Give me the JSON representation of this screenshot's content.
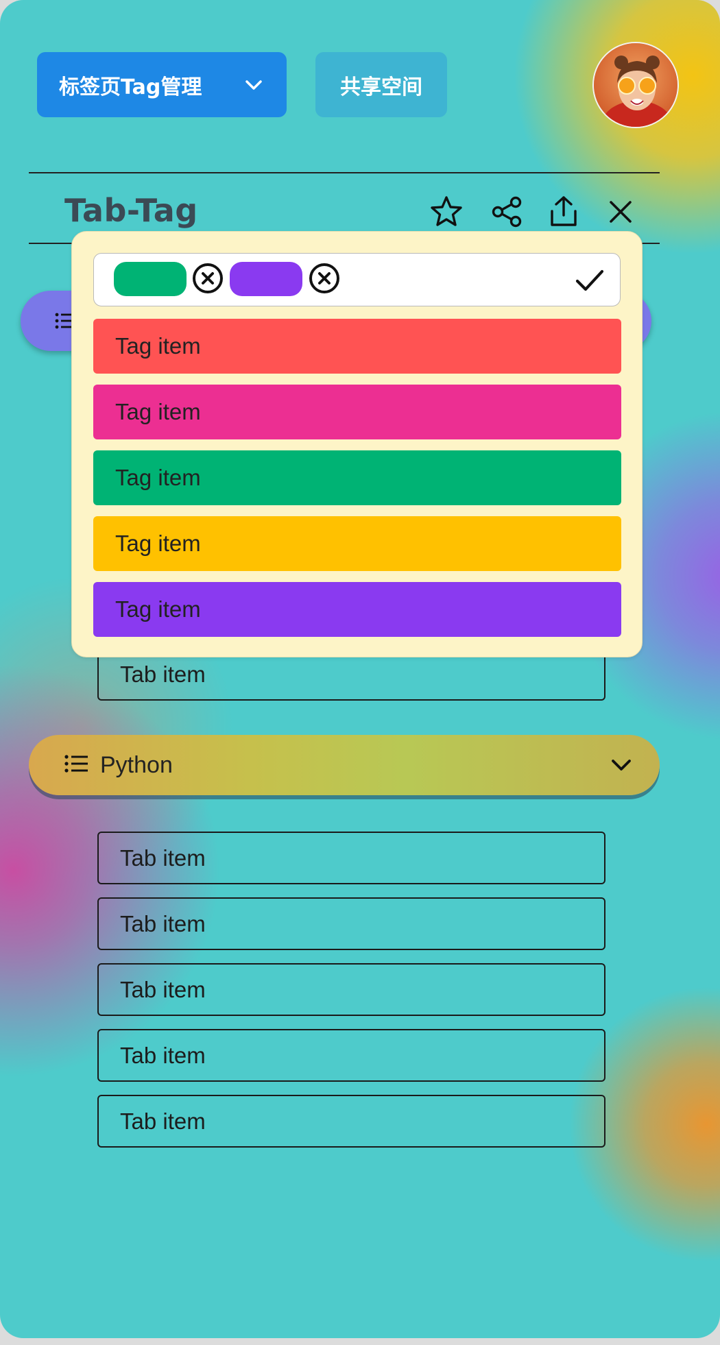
{
  "header": {
    "tag_manager_label": "标签页Tag管理",
    "shared_space_label": "共享空间"
  },
  "toolbar": {
    "title": "Tab-Tag",
    "icons": [
      "star-icon",
      "share-icon",
      "upload-icon",
      "close-icon"
    ]
  },
  "tag_picker": {
    "selected_chips": [
      {
        "color": "#00b374"
      },
      {
        "color": "#8a3af0"
      }
    ],
    "tags": [
      {
        "label": "Tag item",
        "color": "#ff5353"
      },
      {
        "label": "Tag item",
        "color": "#ec2f92"
      },
      {
        "label": "Tag item",
        "color": "#00b374"
      },
      {
        "label": "Tag item",
        "color": "#ffc100"
      },
      {
        "label": "Tag item",
        "color": "#8a3af0"
      }
    ]
  },
  "groups": [
    {
      "label": "",
      "color": "#7a78e8",
      "tabs": [
        "Tab item"
      ]
    },
    {
      "label": "Python",
      "color": "#c8bf4e",
      "tabs": [
        "Tab item",
        "Tab item",
        "Tab item",
        "Tab item",
        "Tab item"
      ]
    }
  ]
}
